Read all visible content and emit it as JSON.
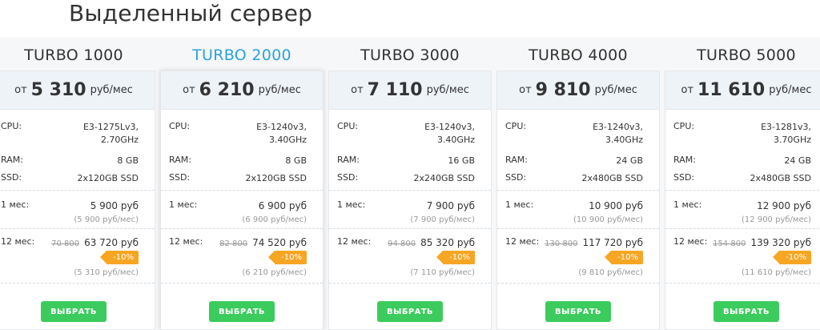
{
  "title": "Выделенный сервер",
  "accent_color": "#2aa3dc",
  "button_color": "#3ccb5d",
  "badge_color": "#f6a623",
  "labels": {
    "cpu": "CPU:",
    "ram": "RAM:",
    "ssd": "SSD:",
    "month1": "1 мес:",
    "month12": "12 мес:",
    "from": "от",
    "per_month": "руб/мес"
  },
  "plans": [
    {
      "name": "TURBO 1000",
      "price": "5 310",
      "cpu": [
        "E3-1275Lv3,",
        "2.70GHz"
      ],
      "ram": "8 GB",
      "ssd": "2x120GB SSD",
      "month_price": "5 900 руб",
      "month_sub": "(5 900 руб/мес)",
      "year_old": "70 800",
      "year_price": "63 720 руб",
      "discount": "-10%",
      "year_sub": "(5 310 руб/мес)",
      "button": "ВЫБРАТЬ"
    },
    {
      "name": "TURBO 2000",
      "price": "6 210",
      "cpu": [
        "E3-1240v3,",
        "3.40GHz"
      ],
      "ram": "8 GB",
      "ssd": "2x120GB SSD",
      "month_price": "6 900 руб",
      "month_sub": "(6 900 руб/мес)",
      "year_old": "82 800",
      "year_price": "74 520 руб",
      "discount": "-10%",
      "year_sub": "(6 210 руб/мес)",
      "button": "ВЫБРАТЬ"
    },
    {
      "name": "TURBO 3000",
      "price": "7 110",
      "cpu": [
        "E3-1240v3,",
        "3.40GHz"
      ],
      "ram": "16 GB",
      "ssd": "2x240GB SSD",
      "month_price": "7 900 руб",
      "month_sub": "(7 900 руб/мес)",
      "year_old": "94 800",
      "year_price": "85 320 руб",
      "discount": "-10%",
      "year_sub": "(7 110 руб/мес)",
      "button": "ВЫБРАТЬ"
    },
    {
      "name": "TURBO 4000",
      "price": "9 810",
      "cpu": [
        "E3-1240v3,",
        "3.40GHz"
      ],
      "ram": "24 GB",
      "ssd": "2x480GB SSD",
      "month_price": "10 900 руб",
      "month_sub": "(10 900 руб/мес)",
      "year_old": "130 800",
      "year_price": "117 720 руб",
      "discount": "-10%",
      "year_sub": "(9 810 руб/мес)",
      "button": "ВЫБРАТЬ"
    },
    {
      "name": "TURBO 5000",
      "price": "11 610",
      "cpu": [
        "E3-1281v3,",
        "3.70GHz"
      ],
      "ram": "24 GB",
      "ssd": "2x480GB SSD",
      "month_price": "12 900 руб",
      "month_sub": "(12 900 руб/мес)",
      "year_old": "154 800",
      "year_price": "139 320 руб",
      "discount": "-10%",
      "year_sub": "(11 610 руб/мес)",
      "button": "ВЫБРАТЬ"
    }
  ]
}
